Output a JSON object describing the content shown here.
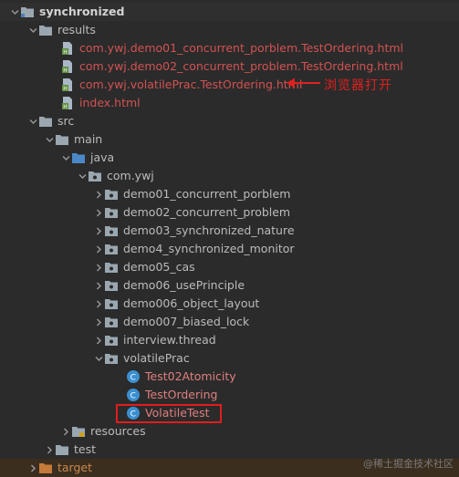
{
  "tree": {
    "root": {
      "label": "synchronized",
      "icon": "folder-icon"
    },
    "results": {
      "label": "results",
      "files": [
        "com.ywj.demo01_concurrent_porblem.TestOrdering.html",
        "com.ywj.demo02_concurrent_problem.TestOrdering.html",
        "com.ywj.volatilePrac.TestOrdering.html",
        "index.html"
      ]
    },
    "src": {
      "label": "src"
    },
    "main": {
      "label": "main"
    },
    "java": {
      "label": "java"
    },
    "package_root": {
      "label": "com.ywj"
    },
    "packages": [
      "demo01_concurrent_porblem",
      "demo02_concurrent_problem",
      "demo03_synchronized_nature",
      "demo4_synchronized_monitor",
      "demo05_cas",
      "demo06_usePrinciple",
      "demo006_object_layout",
      "demo007_biased_lock",
      "interview.thread",
      "volatilePrac"
    ],
    "volatile_classes": [
      "Test02Atomicity",
      "TestOrdering",
      "VolatileTest"
    ],
    "resources": {
      "label": "resources"
    },
    "test": {
      "label": "test"
    },
    "target": {
      "label": "target"
    }
  },
  "annotation": {
    "text": "浏览器打开",
    "color": "#e02020"
  },
  "watermark": {
    "text": "@稀土掘金技术社区"
  },
  "colors": {
    "background": "#2b2b2b",
    "text": "#bbbbbb",
    "error_file": "#d25252",
    "highlight": "#e01e1e"
  }
}
